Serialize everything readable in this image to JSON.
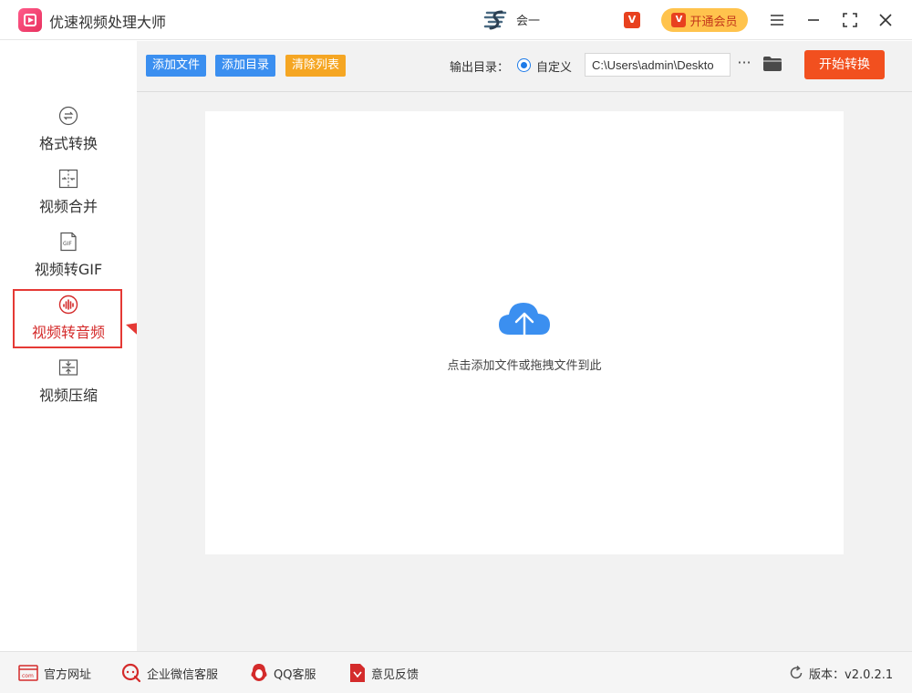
{
  "app": {
    "title": "优速视频处理大师"
  },
  "header": {
    "user_name": "会一",
    "vip_badge": "V",
    "vip_button": "开通会员"
  },
  "sidebar": {
    "items": [
      {
        "label": "格式转换",
        "icon": "format-convert-icon"
      },
      {
        "label": "视频合并",
        "icon": "video-merge-icon"
      },
      {
        "label": "视频转GIF",
        "icon": "gif-icon"
      },
      {
        "label": "视频转音频",
        "icon": "audio-convert-icon",
        "active": true
      },
      {
        "label": "视频压缩",
        "icon": "compress-icon"
      }
    ]
  },
  "toolbar": {
    "add_file": "添加文件",
    "add_dir": "添加目录",
    "clear_list": "清除列表",
    "output_label": "输出目录：",
    "radio_label": "自定义",
    "output_path": "C:\\Users\\admin\\Deskto",
    "more": "···",
    "start": "开始转换"
  },
  "dropzone": {
    "hint": "点击添加文件或拖拽文件到此"
  },
  "footer": {
    "links": [
      {
        "label": "官方网址"
      },
      {
        "label": "企业微信客服"
      },
      {
        "label": "QQ客服"
      },
      {
        "label": "意见反馈"
      }
    ],
    "version": "版本：v2.0.2.1"
  },
  "colors": {
    "accent_blue": "#3b8ff0",
    "clear_orange": "#f5a623",
    "start_red": "#f2501f",
    "vip_yellow": "#ffc34d",
    "active_red": "#d42b2b",
    "cloud_blue": "#3b8ff0"
  }
}
